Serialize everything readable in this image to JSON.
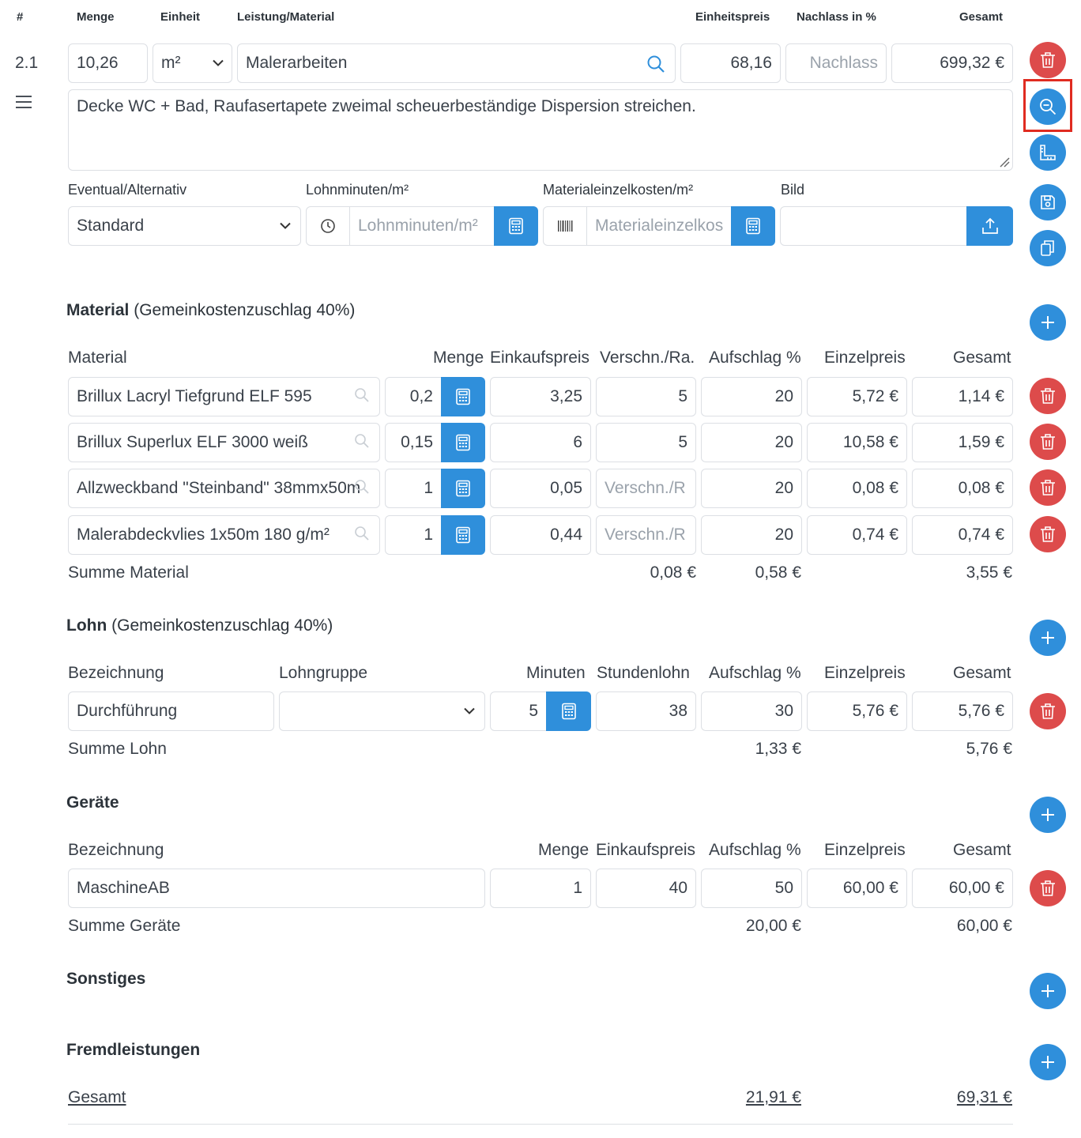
{
  "header": {
    "hash": "#",
    "menge": "Menge",
    "einheit": "Einheit",
    "leistung": "Leistung/Material",
    "einheitspreis": "Einheitspreis",
    "nachlass": "Nachlass in %",
    "gesamt": "Gesamt"
  },
  "position": {
    "number": "2.1",
    "menge": "10,26",
    "einheit": "m²",
    "leistung": "Malerarbeiten",
    "einheitspreis": "68,16",
    "nachlass_placeholder": "Nachlass",
    "gesamt": "699,32 €",
    "description": "Decke WC + Bad, Raufasertapete zweimal scheuerbeständige Dispersion streichen."
  },
  "options": {
    "eventual_label": "Eventual/Alternativ",
    "eventual_value": "Standard",
    "lohnminuten_label": "Lohnminuten/m²",
    "lohnminuten_placeholder": "Lohnminuten/m²",
    "materialkosten_label": "Materialeinzelkosten/m²",
    "materialkosten_placeholder": "Materialeinzelkos",
    "bild_label": "Bild"
  },
  "material": {
    "title": "Material",
    "subtitle": "(Gemeinkostenzuschlag 40%)",
    "columns": [
      "Material",
      "Menge",
      "Einkaufspreis",
      "Verschn./Ra.",
      "Aufschlag %",
      "Einzelpreis",
      "Gesamt"
    ],
    "verschnitt_placeholder": "Verschn./R",
    "rows": [
      {
        "name": "Brillux Lacryl Tiefgrund ELF 595",
        "menge": "0,2",
        "ek": "3,25",
        "verschnitt": "5",
        "aufschlag": "20",
        "einzel": "5,72 €",
        "gesamt": "1,14 €"
      },
      {
        "name": "Brillux Superlux ELF 3000 weiß",
        "menge": "0,15",
        "ek": "6",
        "verschnitt": "5",
        "aufschlag": "20",
        "einzel": "10,58 €",
        "gesamt": "1,59 €"
      },
      {
        "name": "Allzweckband \"Steinband\" 38mmx50m",
        "menge": "1",
        "ek": "0,05",
        "verschnitt": "",
        "aufschlag": "20",
        "einzel": "0,08 €",
        "gesamt": "0,08 €"
      },
      {
        "name": "Malerabdeckvlies 1x50m 180 g/m²",
        "menge": "1",
        "ek": "0,44",
        "verschnitt": "",
        "aufschlag": "20",
        "einzel": "0,74 €",
        "gesamt": "0,74 €"
      }
    ],
    "sum_label": "Summe Material",
    "sum_verschnitt": "0,08 €",
    "sum_aufschlag": "0,58 €",
    "sum_gesamt": "3,55 €"
  },
  "lohn": {
    "title": "Lohn",
    "subtitle": "(Gemeinkostenzuschlag 40%)",
    "columns": [
      "Bezeichnung",
      "Lohngruppe",
      "Minuten",
      "Stundenlohn",
      "Aufschlag %",
      "Einzelpreis",
      "Gesamt"
    ],
    "row": {
      "name": "Durchführung",
      "lohngruppe": "",
      "minuten": "5",
      "stundenlohn": "38",
      "aufschlag": "30",
      "einzel": "5,76 €",
      "gesamt": "5,76 €"
    },
    "sum_label": "Summe Lohn",
    "sum_aufschlag": "1,33 €",
    "sum_gesamt": "5,76 €"
  },
  "geraete": {
    "title": "Geräte",
    "columns": [
      "Bezeichnung",
      "Menge",
      "Einkaufspreis",
      "Aufschlag %",
      "Einzelpreis",
      "Gesamt"
    ],
    "row": {
      "name": "MaschineAB",
      "menge": "1",
      "ek": "40",
      "aufschlag": "50",
      "einzel": "60,00 €",
      "gesamt": "60,00 €"
    },
    "sum_label": "Summe Geräte",
    "sum_aufschlag": "20,00 €",
    "sum_gesamt": "60,00 €"
  },
  "sonstiges": {
    "title": "Sonstiges"
  },
  "fremdleistungen": {
    "title": "Fremdleistungen"
  },
  "total": {
    "label": "Gesamt",
    "aufschlag": "21,91 €",
    "gesamt": "69,31 €"
  },
  "colors": {
    "accent": "#2f8fdb",
    "danger": "#dd4b4b",
    "highlight": "#e02b20"
  }
}
